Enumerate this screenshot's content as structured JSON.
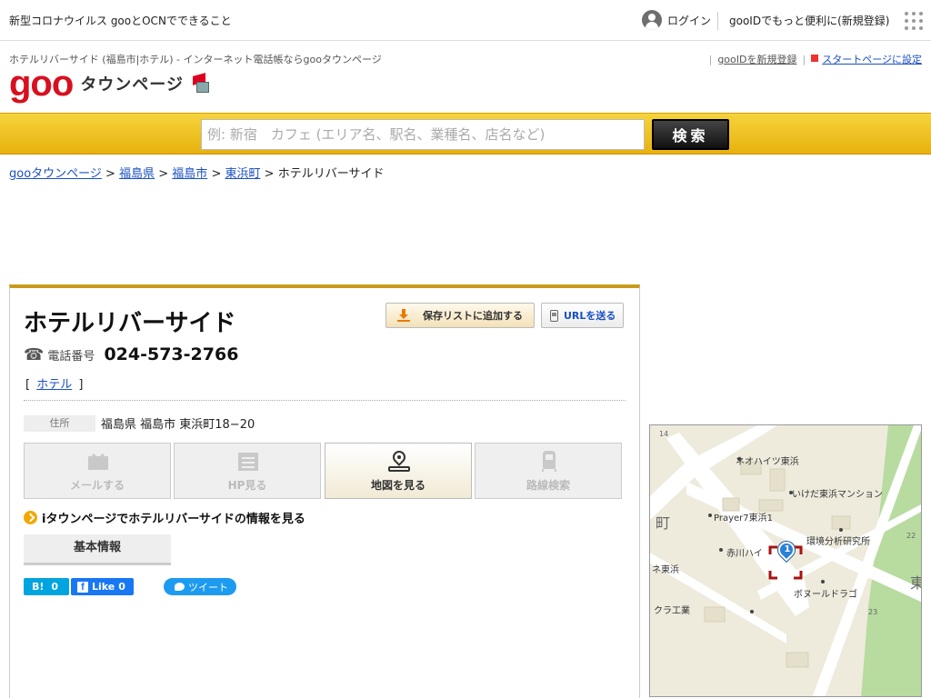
{
  "topbar": {
    "covid_link": "新型コロナウイルス gooとOCNでできること",
    "login_label": "ログイン",
    "register_label": "gooIDでもっと便利に(新規登録)"
  },
  "header": {
    "page_desc": "ホテルリバーサイド (福島市|ホテル) - インターネット電話帳ならgooタウンページ",
    "new_gooid_label": "gooIDを新規登録",
    "startpage_label": "スタートページに設定",
    "logo_text": "goo",
    "logo_sub": "タウンページ"
  },
  "search": {
    "placeholder": "例: 新宿　カフェ (エリア名、駅名、業種名、店名など)",
    "value": "",
    "button_label": "検索"
  },
  "breadcrumb": {
    "items": [
      "gooタウンページ",
      "福島県",
      "福島市",
      "東浜町"
    ],
    "current": "ホテルリバーサイド",
    "sep": ">"
  },
  "shop": {
    "name": "ホテルリバーサイド",
    "phone_label": "電話番号",
    "phone": "024-573-2766",
    "category": "ホテル",
    "bracket_open": "[",
    "bracket_close": "]",
    "address_label": "住所",
    "address": "福島県 福島市 東浜町18−20"
  },
  "actions": {
    "save_label": "保存リストに追加する",
    "url_label": "URLを送る",
    "mail_label": "メールする",
    "hp_label": "HP見る",
    "map_label": "地図を見る",
    "route_label": "路線検索"
  },
  "info": {
    "itown_label": "iタウンページでホテルリバーサイドの情報を見る",
    "tab_basic": "基本情報"
  },
  "share": {
    "hatena_label": "B!",
    "hatena_count": "0",
    "fb_label": "Like",
    "fb_count": "0",
    "tweet_label": "ツイート"
  },
  "map": {
    "labels": {
      "neo_heights": "ネオハイツ東浜",
      "ikeda": "いけだ東浜マンション",
      "prayer": "Prayer7東浜1",
      "kankyo": "環境分析研究所",
      "akagawa": "赤川ハイ",
      "ne_higashi": "ネ東浜",
      "bonheur": "ボヌールドラゴ",
      "kura": "クラ工業",
      "machi": "町",
      "higashi": "東",
      "n14": "14",
      "n22": "22",
      "n23": "23"
    },
    "marker_number": "1"
  },
  "colors": {
    "accent": "#e7b10d",
    "card_top": "#c99a1a",
    "link": "#1a4fc4",
    "brand": "#d80f1f"
  }
}
